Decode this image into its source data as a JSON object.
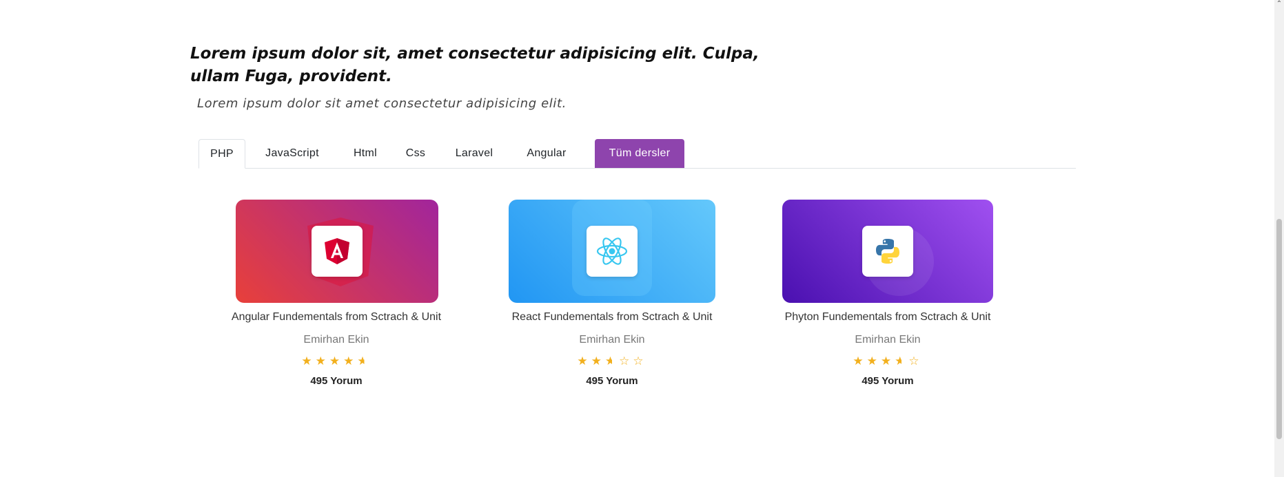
{
  "heading": "Lorem ipsum dolor sit, amet consectetur adipisicing elit. Culpa, ullam Fuga, provident.",
  "subheading": "Lorem ipsum dolor sit amet consectetur adipisicing elit.",
  "tabs": [
    {
      "label": "PHP",
      "active": true
    },
    {
      "label": "JavaScript"
    },
    {
      "label": "Html"
    },
    {
      "label": "Css"
    },
    {
      "label": "Laravel"
    },
    {
      "label": "Angular"
    },
    {
      "label": "Tüm dersler",
      "highlight": true
    }
  ],
  "accent_color": "#8e44ad",
  "courses": [
    {
      "title": "Angular Fundementals from Sctrach & Unit",
      "author": "Emirhan Ekin",
      "rating": 4.5,
      "reviews": "495 Yorum",
      "icon": "angular-icon",
      "gradient": [
        "#e8403a",
        "#a1259c"
      ]
    },
    {
      "title": "React Fundementals from Sctrach & Unit",
      "author": "Emirhan Ekin",
      "rating": 2.5,
      "reviews": "495 Yorum",
      "icon": "react-icon",
      "gradient": [
        "#2196f3",
        "#64c8fb"
      ]
    },
    {
      "title": "Phyton Fundementals from Sctrach & Unit",
      "author": "Emirhan Ekin",
      "rating": 3.5,
      "reviews": "495 Yorum",
      "icon": "python-icon",
      "gradient": [
        "#4a10b0",
        "#a050f0"
      ]
    }
  ],
  "star_color": "#f2b01e"
}
